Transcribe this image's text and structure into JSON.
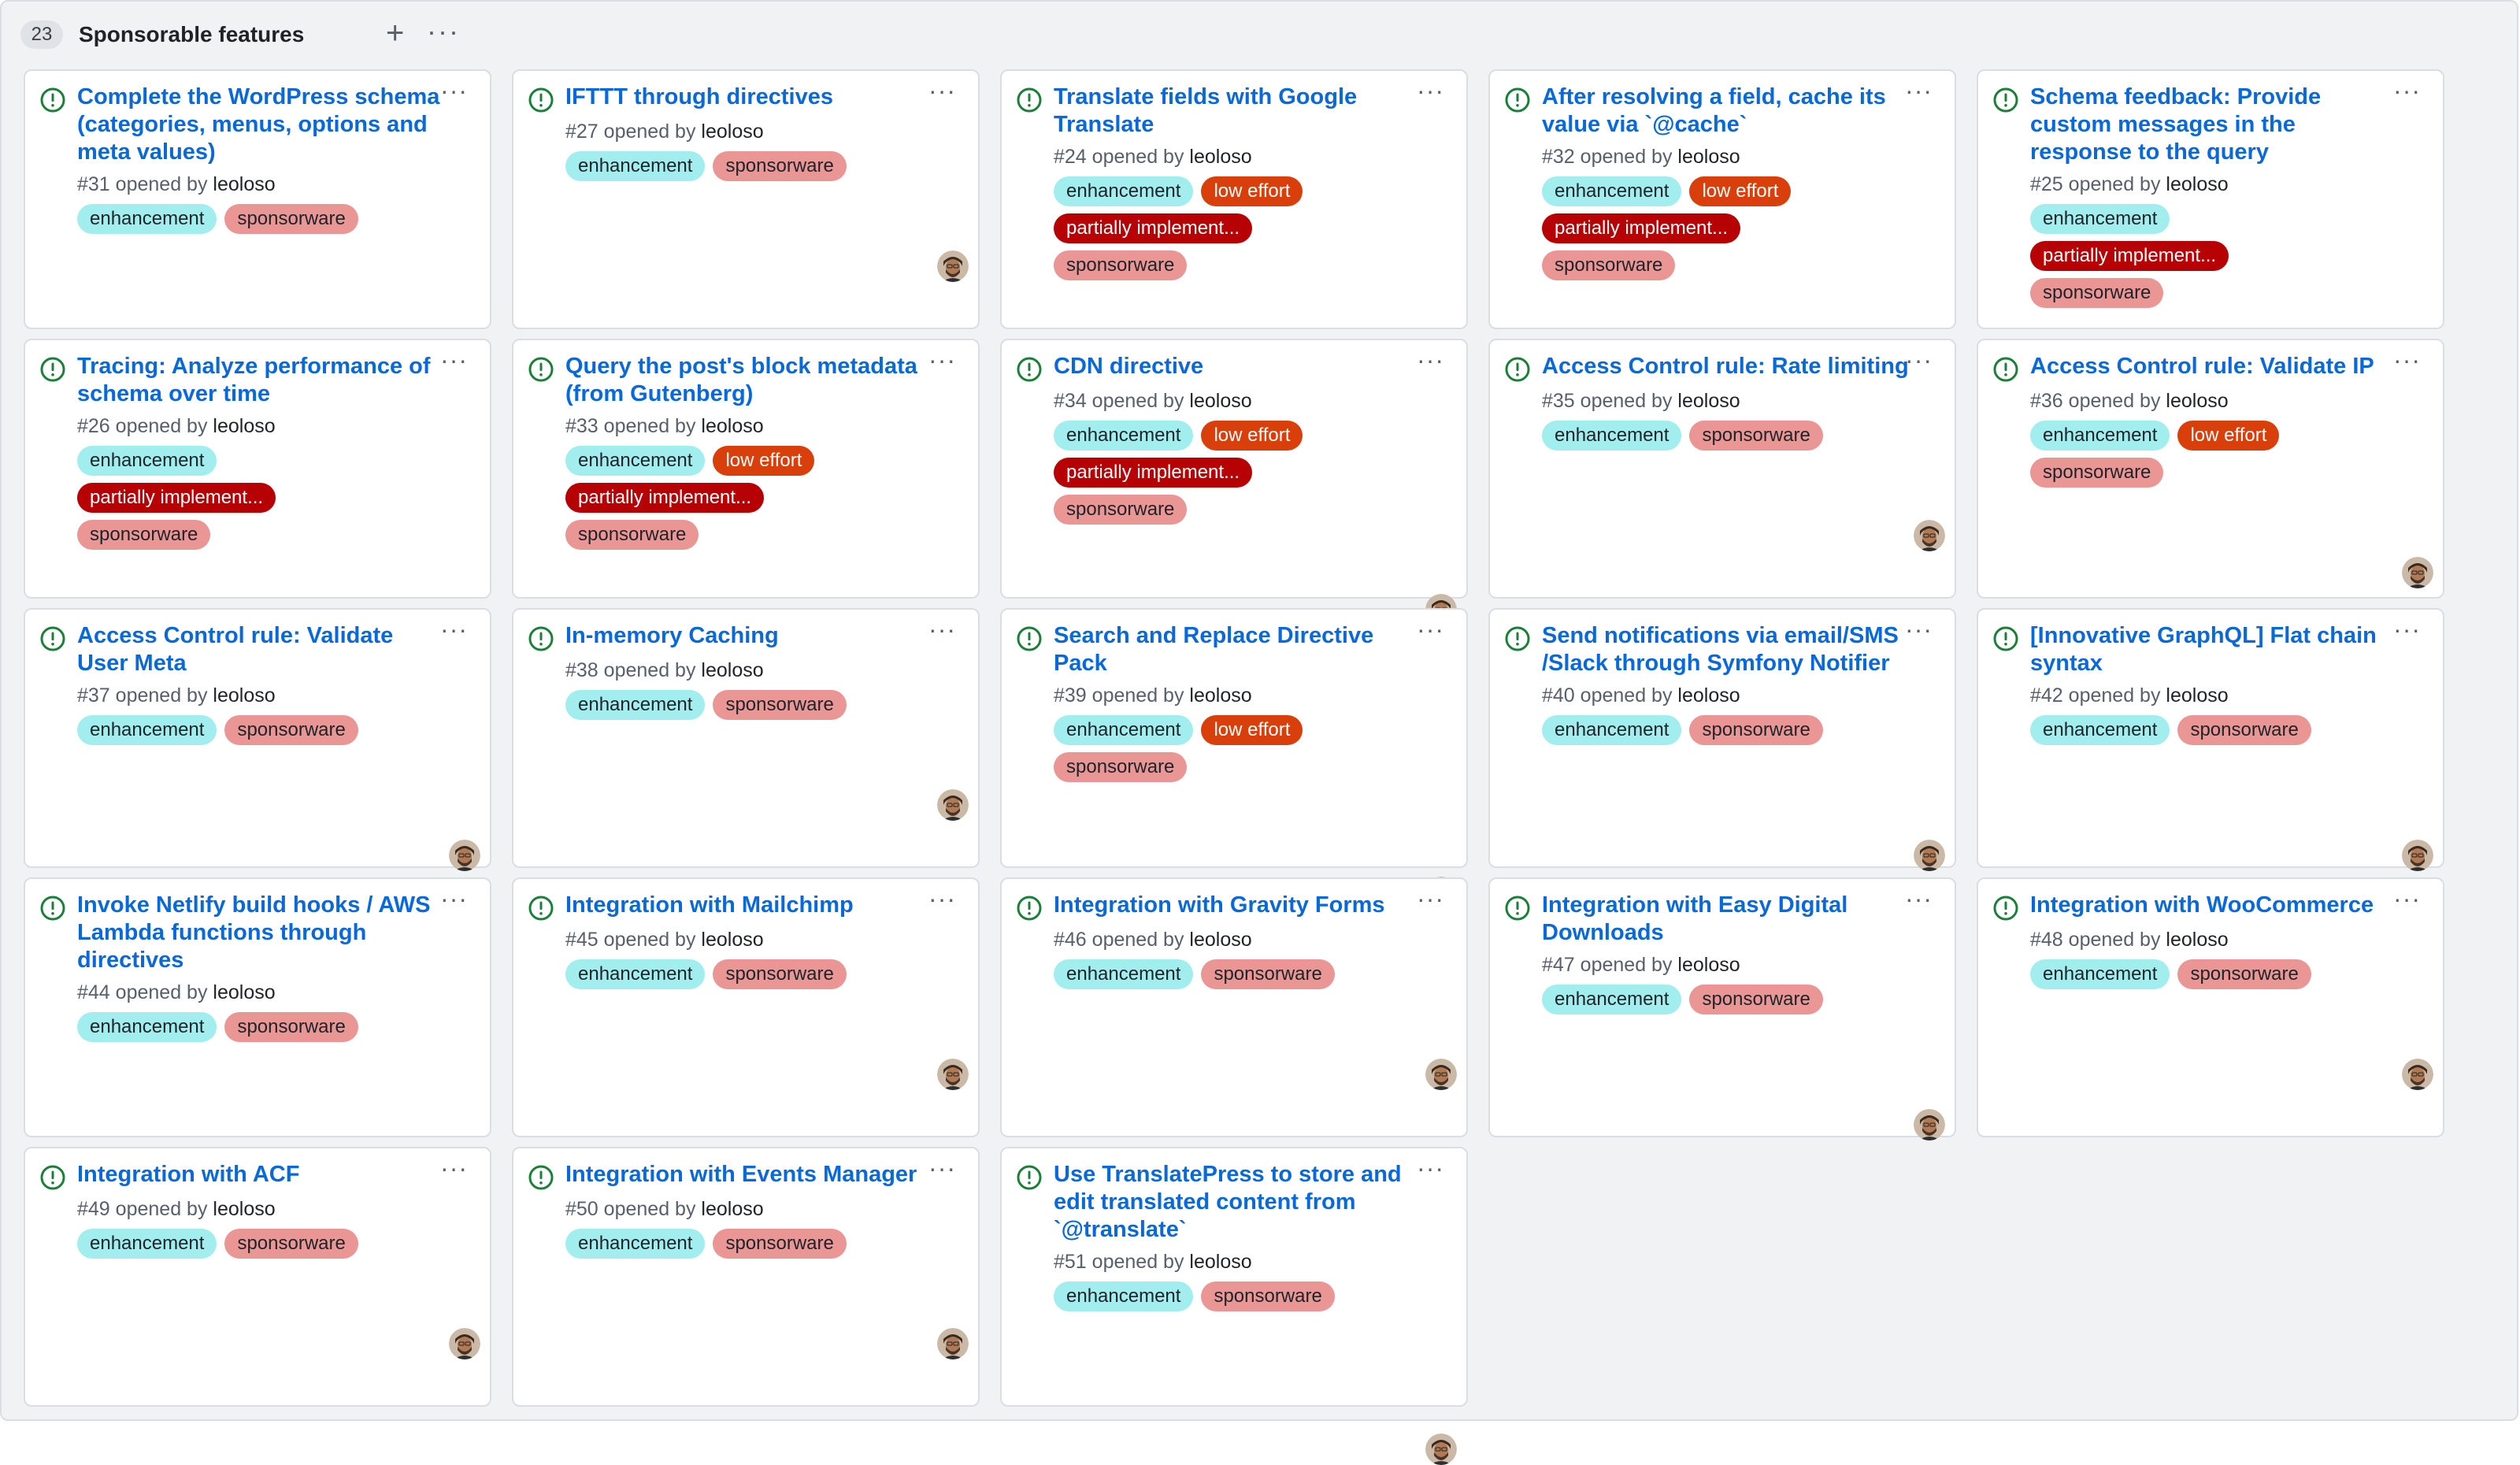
{
  "column": {
    "count": "23",
    "title": "Sponsorable features",
    "add_icon": "+",
    "more_icon": "···"
  },
  "colors": {
    "background": "#f1f2f4",
    "title_link": "#0969da",
    "open_issue_icon": "#1a7f37",
    "enhancement": "#a2eeef",
    "sponsorware": "#e99695",
    "low_effort": "#d93f0b",
    "partially_implemented": "#b60205"
  },
  "cards": [
    {
      "title": "Complete the WordPress schema (categories, menus, options and meta values)",
      "number": "#31",
      "opened_by": "opened by",
      "author": "leoloso",
      "labels": [
        "enhancement",
        "sponsorware"
      ]
    },
    {
      "title": "IFTTT through directives",
      "number": "#27",
      "opened_by": "opened by",
      "author": "leoloso",
      "labels": [
        "enhancement",
        "sponsorware"
      ]
    },
    {
      "title": "Translate fields with Google Translate",
      "number": "#24",
      "opened_by": "opened by",
      "author": "leoloso",
      "labels": [
        "enhancement",
        "low effort",
        "partially implement...",
        "sponsorware"
      ]
    },
    {
      "title": "After resolving a field, cache its value via `@cache`",
      "number": "#32",
      "opened_by": "opened by",
      "author": "leoloso",
      "labels": [
        "enhancement",
        "low effort",
        "partially implement...",
        "sponsorware"
      ]
    },
    {
      "title": "Schema feedback: Provide custom messages in the response to the query",
      "number": "#25",
      "opened_by": "opened by",
      "author": "leoloso",
      "labels": [
        "enhancement",
        "partially implement...",
        "sponsorware"
      ]
    },
    {
      "title": "Tracing: Analyze performance of schema over time",
      "number": "#26",
      "opened_by": "opened by",
      "author": "leoloso",
      "labels": [
        "enhancement",
        "partially implement...",
        "sponsorware"
      ]
    },
    {
      "title": "Query the post's block metadata (from Gutenberg)",
      "number": "#33",
      "opened_by": "opened by",
      "author": "leoloso",
      "labels": [
        "enhancement",
        "low effort",
        "partially implement...",
        "sponsorware"
      ]
    },
    {
      "title": "CDN directive",
      "number": "#34",
      "opened_by": "opened by",
      "author": "leoloso",
      "labels": [
        "enhancement",
        "low effort",
        "partially implement...",
        "sponsorware"
      ]
    },
    {
      "title": "Access Control rule: Rate limiting",
      "number": "#35",
      "opened_by": "opened by",
      "author": "leoloso",
      "labels": [
        "enhancement",
        "sponsorware"
      ]
    },
    {
      "title": "Access Control rule: Validate IP",
      "number": "#36",
      "opened_by": "opened by",
      "author": "leoloso",
      "labels": [
        "enhancement",
        "low effort",
        "sponsorware"
      ]
    },
    {
      "title": "Access Control rule: Validate User Meta",
      "number": "#37",
      "opened_by": "opened by",
      "author": "leoloso",
      "labels": [
        "enhancement",
        "sponsorware"
      ]
    },
    {
      "title": "In-memory Caching",
      "number": "#38",
      "opened_by": "opened by",
      "author": "leoloso",
      "labels": [
        "enhancement",
        "sponsorware"
      ]
    },
    {
      "title": "Search and Replace Directive Pack",
      "number": "#39",
      "opened_by": "opened by",
      "author": "leoloso",
      "labels": [
        "enhancement",
        "low effort",
        "sponsorware"
      ]
    },
    {
      "title": "Send notifications via email/SMS /Slack through Symfony Notifier",
      "number": "#40",
      "opened_by": "opened by",
      "author": "leoloso",
      "labels": [
        "enhancement",
        "sponsorware"
      ]
    },
    {
      "title": "[Innovative GraphQL] Flat chain syntax",
      "number": "#42",
      "opened_by": "opened by",
      "author": "leoloso",
      "labels": [
        "enhancement",
        "sponsorware"
      ]
    },
    {
      "title": "Invoke Netlify build hooks / AWS Lambda functions through directives",
      "number": "#44",
      "opened_by": "opened by",
      "author": "leoloso",
      "labels": [
        "enhancement",
        "sponsorware"
      ]
    },
    {
      "title": "Integration with Mailchimp",
      "number": "#45",
      "opened_by": "opened by",
      "author": "leoloso",
      "labels": [
        "enhancement",
        "sponsorware"
      ]
    },
    {
      "title": "Integration with Gravity Forms",
      "number": "#46",
      "opened_by": "opened by",
      "author": "leoloso",
      "labels": [
        "enhancement",
        "sponsorware"
      ]
    },
    {
      "title": "Integration with Easy Digital Downloads",
      "number": "#47",
      "opened_by": "opened by",
      "author": "leoloso",
      "labels": [
        "enhancement",
        "sponsorware"
      ]
    },
    {
      "title": "Integration with WooCommerce",
      "number": "#48",
      "opened_by": "opened by",
      "author": "leoloso",
      "labels": [
        "enhancement",
        "sponsorware"
      ]
    },
    {
      "title": "Integration with ACF",
      "number": "#49",
      "opened_by": "opened by",
      "author": "leoloso",
      "labels": [
        "enhancement",
        "sponsorware"
      ]
    },
    {
      "title": "Integration with Events Manager",
      "number": "#50",
      "opened_by": "opened by",
      "author": "leoloso",
      "labels": [
        "enhancement",
        "sponsorware"
      ]
    },
    {
      "title": "Use TranslatePress to store and edit translated content from `@translate`",
      "number": "#51",
      "opened_by": "opened by",
      "author": "leoloso",
      "labels": [
        "enhancement",
        "sponsorware"
      ]
    }
  ]
}
